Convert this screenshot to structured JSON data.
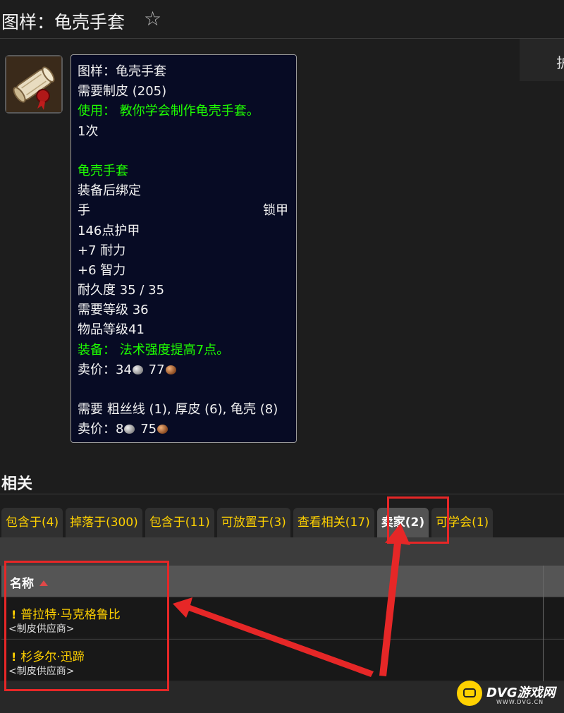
{
  "header": {
    "title": "图样：龟壳手套",
    "favorite_icon": "star-outline-icon"
  },
  "side_panel": {
    "text": "护"
  },
  "item_icon": "recipe-scroll-icon",
  "tooltip": {
    "name": "图样：龟壳手套",
    "requires": "需要制皮 (205)",
    "use": "使用：  教你学会制作龟壳手套。",
    "charges": "1次",
    "crafted_name": "龟壳手套",
    "bind": "装备后绑定",
    "slot": "手",
    "armor_type": "锁甲",
    "armor": "146点护甲",
    "stat1": "+7 耐力",
    "stat2": "+6 智力",
    "durability": "耐久度 35 / 35",
    "req_level": "需要等级 36",
    "item_level": "物品等级41",
    "equip": "装备：  法术强度提高7点。",
    "sell1": {
      "label": "卖价：",
      "silver": "34",
      "copper": "77"
    },
    "reagents": "需要 粗丝线 (1), 厚皮 (6), 龟壳 (8)",
    "sell2": {
      "label": "卖价：",
      "silver": "8",
      "copper": "75"
    }
  },
  "related": {
    "title": "相关",
    "tabs": [
      {
        "label": "包含于(4)"
      },
      {
        "label": "掉落于(300)"
      },
      {
        "label": "包含于(11)"
      },
      {
        "label": "可放置于(3)"
      },
      {
        "label": "查看相关(17)"
      },
      {
        "label": "卖家(2)"
      },
      {
        "label": "可学会(1)"
      }
    ],
    "active_tab": "卖家(2)",
    "table": {
      "column_name": "名称",
      "rows": [
        {
          "name": "普拉特·马克格鲁比",
          "subtitle": "<制皮供应商>"
        },
        {
          "name": "杉多尔·迅蹄",
          "subtitle": "<制皮供应商>"
        }
      ]
    }
  },
  "watermark": {
    "brand": "DVG游戏网",
    "url": "WWW.DVG.CN"
  },
  "colors": {
    "green": "#1eff00",
    "gold": "#ffd100",
    "annotation_red": "#e62727"
  }
}
